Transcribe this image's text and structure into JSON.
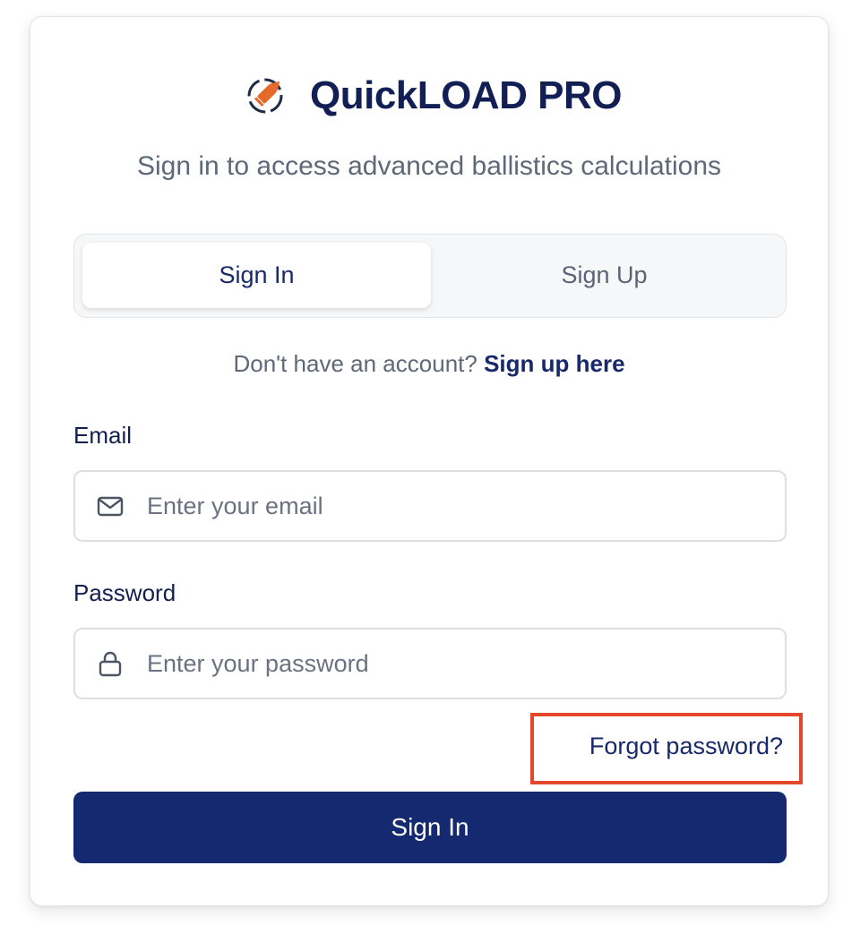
{
  "brand": {
    "title": "QuickLOAD PRO",
    "logo_icon": "bullet-target-icon",
    "accent_color": "#e4692b",
    "text_color": "#121f55"
  },
  "subtitle": "Sign in to access advanced ballistics calculations",
  "tabs": [
    {
      "label": "Sign In",
      "active": true
    },
    {
      "label": "Sign Up",
      "active": false
    }
  ],
  "switch_prompt": {
    "text": "Don't have an account?",
    "link": "Sign up here"
  },
  "form": {
    "email": {
      "label": "Email",
      "placeholder": "Enter your email",
      "value": "",
      "icon": "mail-icon"
    },
    "password": {
      "label": "Password",
      "placeholder": "Enter your password",
      "value": "",
      "icon": "lock-icon"
    },
    "forgot_link": "Forgot password?",
    "submit_label": "Sign In"
  },
  "highlight_color": "#e4472b",
  "primary_color": "#14296f"
}
